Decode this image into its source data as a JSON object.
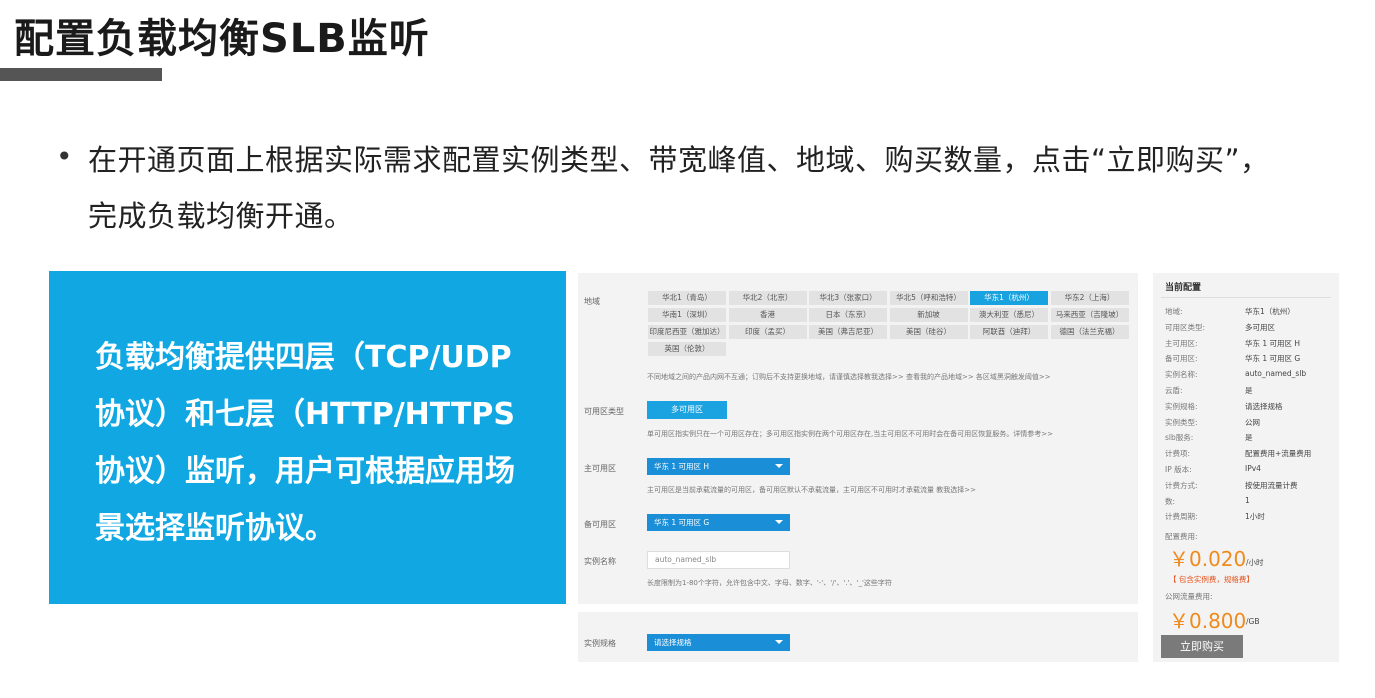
{
  "slide": {
    "title": "配置负载均衡SLB监听",
    "bullet": "在开通页面上根据实际需求配置实例类型、带宽峰值、地域、购买数量，点击“立即购买”，完成负载均衡开通。"
  },
  "callout": {
    "text": "负载均衡提供四层（TCP/UDP协议）和七层（HTTP/HTTPS协议）监听，用户可根据应用场景选择监听协议。"
  },
  "form": {
    "region_label": "地域",
    "regions": [
      "华北1（青岛）",
      "华北2（北京）",
      "华北3（张家口）",
      "华北5（呼和浩特）",
      "华东1（杭州）",
      "华东2（上海）",
      "华南1（深圳）",
      "香港",
      "日本（东京）",
      "新加坡",
      "澳大利亚（悉尼）",
      "马来西亚（吉隆坡）",
      "印度尼西亚（雅加达）",
      "印度（孟买）",
      "美国（弗吉尼亚）",
      "美国（硅谷）",
      "阿联酋（迪拜）",
      "德国（法兰克福）",
      "英国（伦敦）"
    ],
    "region_hint": "不同地域之间的产品内网不互通；订购后不支持更换地域，请谨慎选择教我选择>> 查看我的产品地域>> 各区域黑洞触发阈值>>",
    "zone_type_label": "可用区类型",
    "zone_type_value": "多可用区",
    "zone_type_hint": "单可用区指实例只在一个可用区存在；多可用区指实例在两个可用区存在,当主可用区不可用时会在备可用区恢复服务。详情参考>>",
    "primary_zone_label": "主可用区",
    "primary_zone_value": "华东 1 可用区 H",
    "primary_zone_hint": "主可用区是当前承载流量的可用区，备可用区默认不承载流量，主可用区不可用时才承载流量 教我选择>>",
    "backup_zone_label": "备可用区",
    "backup_zone_value": "华东 1 可用区 G",
    "instance_name_label": "实例名称",
    "instance_name_value": "auto_named_slb",
    "instance_name_hint": "长度限制为1-80个字符，允许包含中文、字母、数字、'-'、'/'、'.'、'_'这些字符",
    "spec_label": "实例规格",
    "spec_value": "请选择规格"
  },
  "summary": {
    "title": "当前配置",
    "rows": [
      {
        "k": "地域:",
        "v": "华东1（杭州）"
      },
      {
        "k": "可用区类型:",
        "v": "多可用区"
      },
      {
        "k": "主可用区:",
        "v": "华东 1 可用区 H"
      },
      {
        "k": "备可用区:",
        "v": "华东 1 可用区 G"
      },
      {
        "k": "实例名称:",
        "v": "auto_named_slb"
      },
      {
        "k": "云盾:",
        "v": "是"
      },
      {
        "k": "实例规格:",
        "v": "请选择规格"
      },
      {
        "k": "实例类型:",
        "v": "公网"
      },
      {
        "k": "slb服务:",
        "v": "是"
      },
      {
        "k": "计费项:",
        "v": "配置费用+流量费用"
      },
      {
        "k": "IP 版本:",
        "v": "IPv4"
      },
      {
        "k": "计费方式:",
        "v": "按使用流量计费"
      },
      {
        "k": "数:",
        "v": "1"
      },
      {
        "k": "计费周期:",
        "v": "1小时"
      }
    ],
    "config_fee_label": "配置费用:",
    "config_price": "￥0.020",
    "config_unit": "/小时",
    "note": "【 包含实例费，规格费】",
    "traffic_fee_label": "公网流量费用:",
    "traffic_price": "￥0.800",
    "traffic_unit": "/GB",
    "buy_label": "立即购买"
  }
}
